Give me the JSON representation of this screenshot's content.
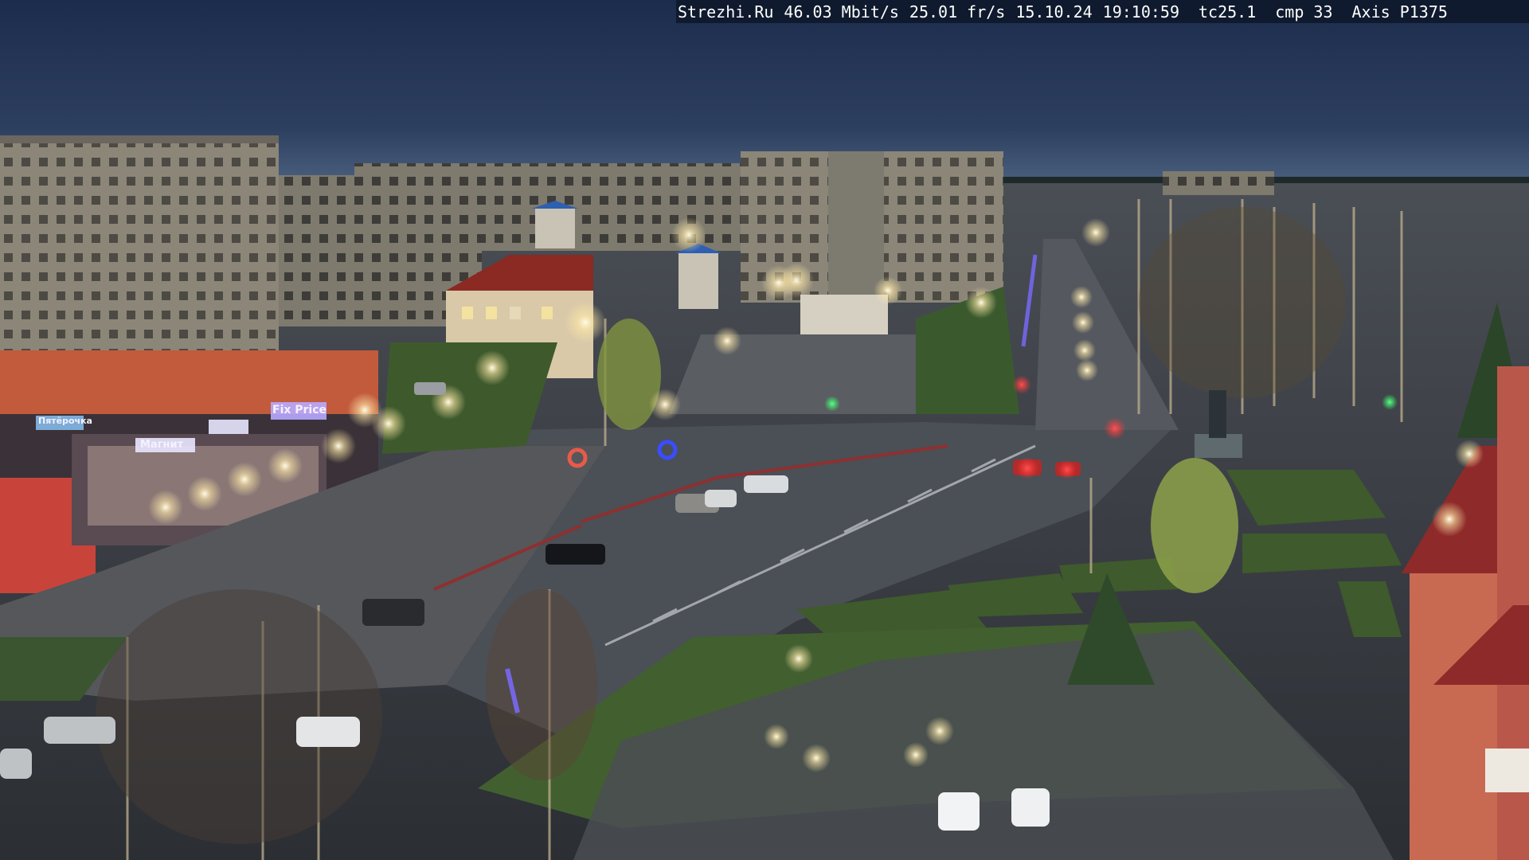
{
  "overlay": {
    "site": "Strezhi.Ru",
    "bitrate": "46.03 Mbit/s",
    "framerate": "25.01 fr/s",
    "date": "15.10.24",
    "time": "19:10:59",
    "tc": "tc25.1",
    "cmp": "cmp 33",
    "camera": "Axis P1375"
  },
  "storefront_signs": [
    "Пятёрочка",
    "Магнит",
    "Fix Price"
  ],
  "colors": {
    "sky_top": "#1c2c4c",
    "sky_bottom": "#4a5f7e",
    "ground": "#3a3f46",
    "grass": "#3f5a2c",
    "building": "#8a8578",
    "brick": "#c84a3a",
    "lamp": "#fff6d6"
  }
}
